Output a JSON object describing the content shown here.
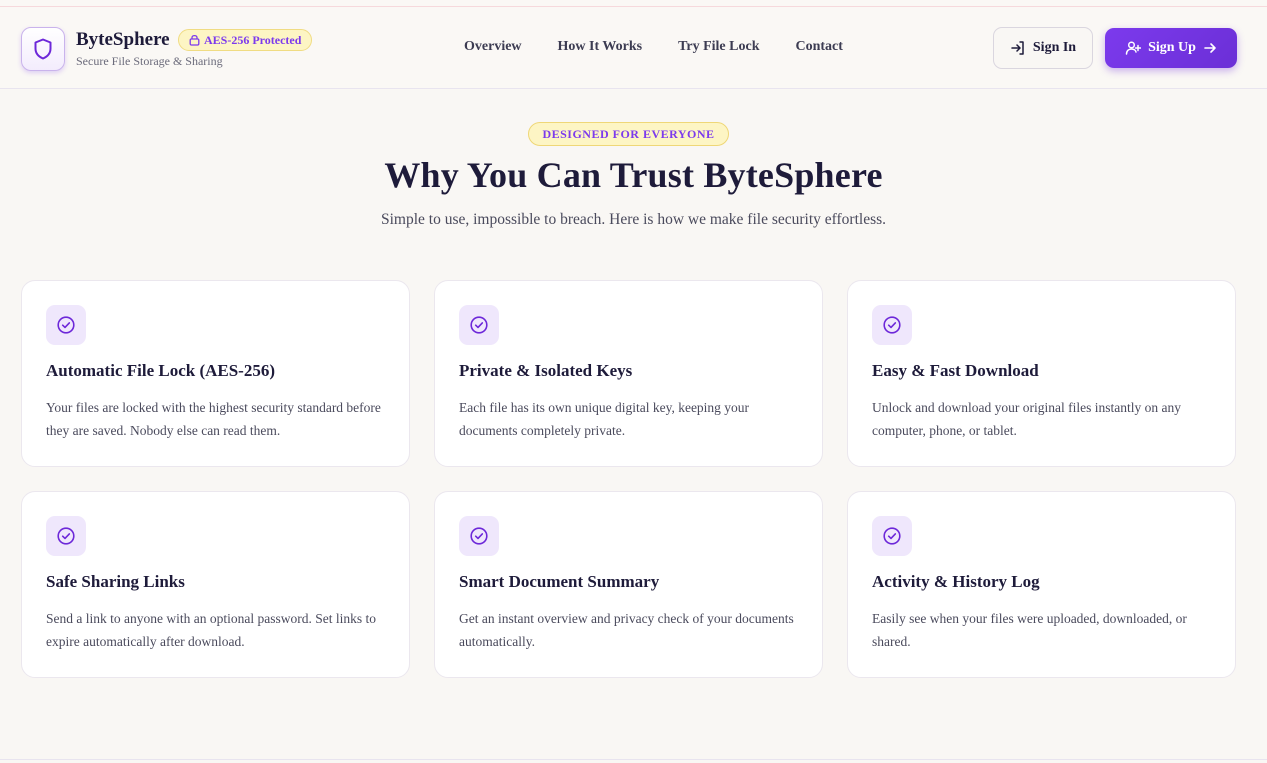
{
  "brand": {
    "name": "ByteSphere",
    "badge": "AES-256 Protected",
    "tagline": "Secure File Storage & Sharing",
    "logo_icon": "shield-icon",
    "accent_color": "#7c3aed"
  },
  "nav": {
    "items": [
      {
        "label": "Overview"
      },
      {
        "label": "How It Works"
      },
      {
        "label": "Try File Lock"
      },
      {
        "label": "Contact"
      }
    ]
  },
  "header_actions": {
    "signin_label": "Sign In",
    "signin_icon": "login-icon",
    "signup_label": "Sign Up",
    "signup_icon": "user-plus-icon",
    "signup_trailing_icon": "arrow-right-icon"
  },
  "hero": {
    "eyebrow": "DESIGNED FOR EVERYONE",
    "title": "Why You Can Trust ByteSphere",
    "subtitle": "Simple to use, impossible to breach. Here is how we make file security effortless."
  },
  "features": [
    {
      "title": "Automatic File Lock (AES-256)",
      "desc": "Your files are locked with the highest security standard before they are saved. Nobody else can read them.",
      "icon": "check-circle-icon"
    },
    {
      "title": "Private & Isolated Keys",
      "desc": "Each file has its own unique digital key, keeping your documents completely private.",
      "icon": "check-circle-icon"
    },
    {
      "title": "Easy & Fast Download",
      "desc": "Unlock and download your original files instantly on any computer, phone, or tablet.",
      "icon": "check-circle-icon"
    },
    {
      "title": "Safe Sharing Links",
      "desc": "Send a link to anyone with an optional password. Set links to expire automatically after download.",
      "icon": "check-circle-icon"
    },
    {
      "title": "Smart Document Summary",
      "desc": "Get an instant overview and privacy check of your documents automatically.",
      "icon": "check-circle-icon"
    },
    {
      "title": "Activity & History Log",
      "desc": "Easily see when your files were uploaded, downloaded, or shared.",
      "icon": "check-circle-icon"
    }
  ]
}
